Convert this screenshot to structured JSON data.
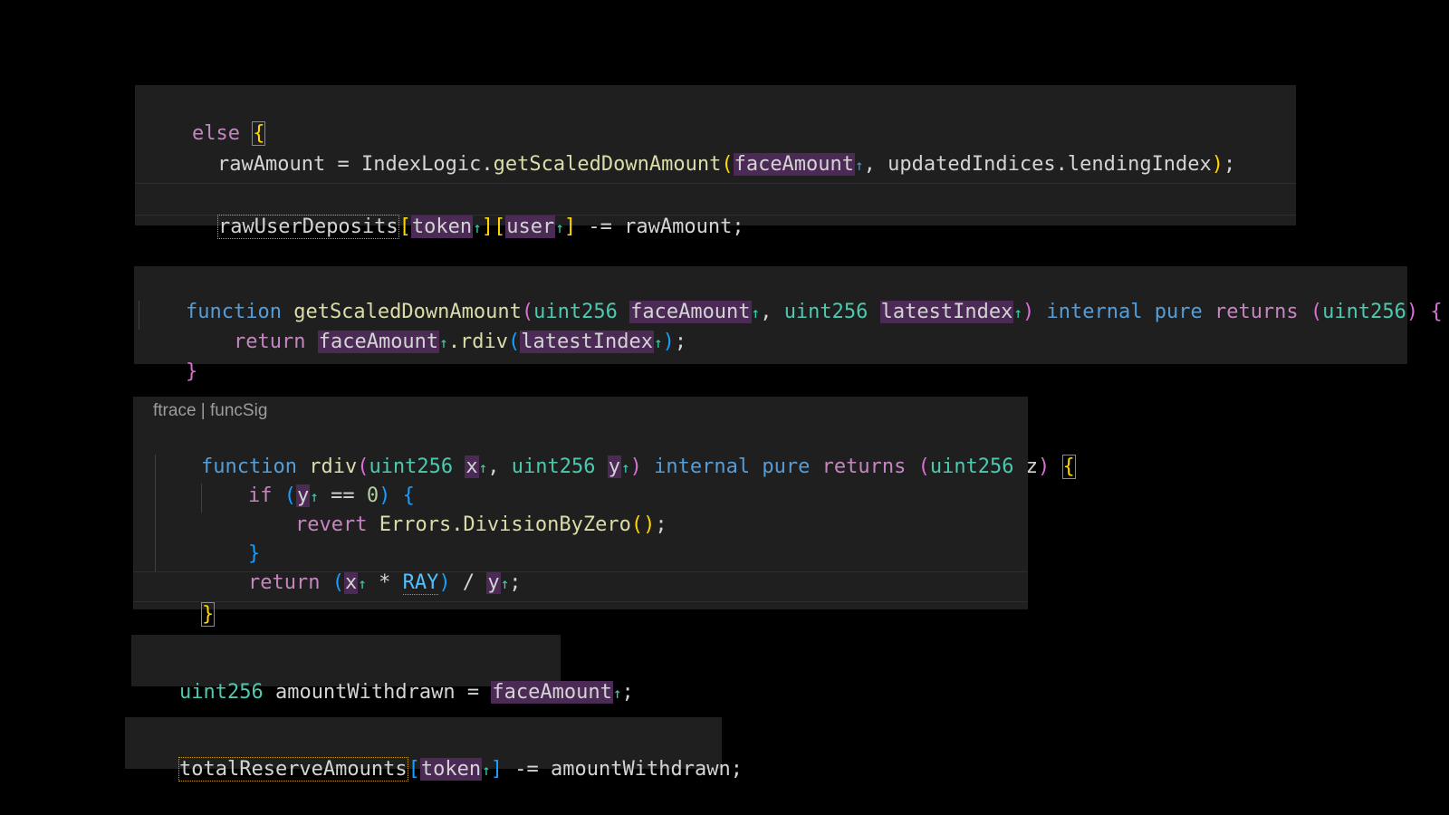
{
  "snippet1": {
    "kw_else": "else",
    "brace_open": "{",
    "var_rawAmount": "rawAmount",
    "op_assign": " = ",
    "obj_IndexLogic": "IndexLogic",
    "dot": ".",
    "fn_getScaledDownAmount": "getScaledDownAmount",
    "paren_open": "(",
    "arg_faceAmount": "faceAmount",
    "arrow": "↑",
    "comma": ", ",
    "arg_updatedIndices": "updatedIndices.lendingIndex",
    "paren_close": ")",
    "semicolon": ";",
    "var_rawUserDeposits": "rawUserDeposits",
    "br_open": "[",
    "idx_token": "token",
    "br_close": "]",
    "idx_user": "user",
    "op_sub_assign": " -= ",
    "rhs_rawAmount": "rawAmount;"
  },
  "snippet2": {
    "kw_function": "function",
    "fn_name": "getScaledDownAmount",
    "paren_open": "(",
    "type_uint256": "uint256",
    "param_faceAmount": "faceAmount",
    "arrow": "↑",
    "comma": ", ",
    "param_latestIndex": "latestIndex",
    "paren_close": ")",
    "kw_internal": "internal",
    "kw_pure": "pure",
    "kw_returns": "returns",
    "ret_open": "(",
    "ret_close": ")",
    "brace_open": "{",
    "kw_return": "return",
    "call_rdiv": ".rdiv",
    "semicolon": ";",
    "brace_close": "}"
  },
  "snippet3": {
    "codelens": "ftrace | funcSig",
    "kw_function": "function",
    "fn_name": "rdiv",
    "paren_open": "(",
    "type_uint256": "uint256",
    "param_x": "x",
    "arrow": "↑",
    "comma": ", ",
    "param_y": "y",
    "paren_close": ")",
    "kw_internal": "internal",
    "kw_pure": "pure",
    "kw_returns": "returns",
    "ret_z": "z",
    "brace_open": "{",
    "kw_if": "if",
    "op_eq": " == ",
    "num_zero": "0",
    "kw_revert": "revert",
    "err_call": "Errors.DivisionByZero",
    "call_parens": "()",
    "semicolon": ";",
    "brace_close": "}",
    "kw_return": "return",
    "op_mul": " * ",
    "const_ray": "RAY",
    "op_div": " / "
  },
  "snippet4": {
    "type_uint256": "uint256",
    "var_amountWithdrawn": "amountWithdrawn",
    "op_assign": " = ",
    "val_faceAmount": "faceAmount",
    "arrow": "↑",
    "semicolon": ";"
  },
  "snippet5": {
    "var_totalReserveAmounts": "totalReserveAmounts",
    "br_open": "[",
    "idx_token": "token",
    "arrow": "↑",
    "br_close": "]",
    "op_sub_assign": " -= ",
    "rhs": "amountWithdrawn;"
  }
}
